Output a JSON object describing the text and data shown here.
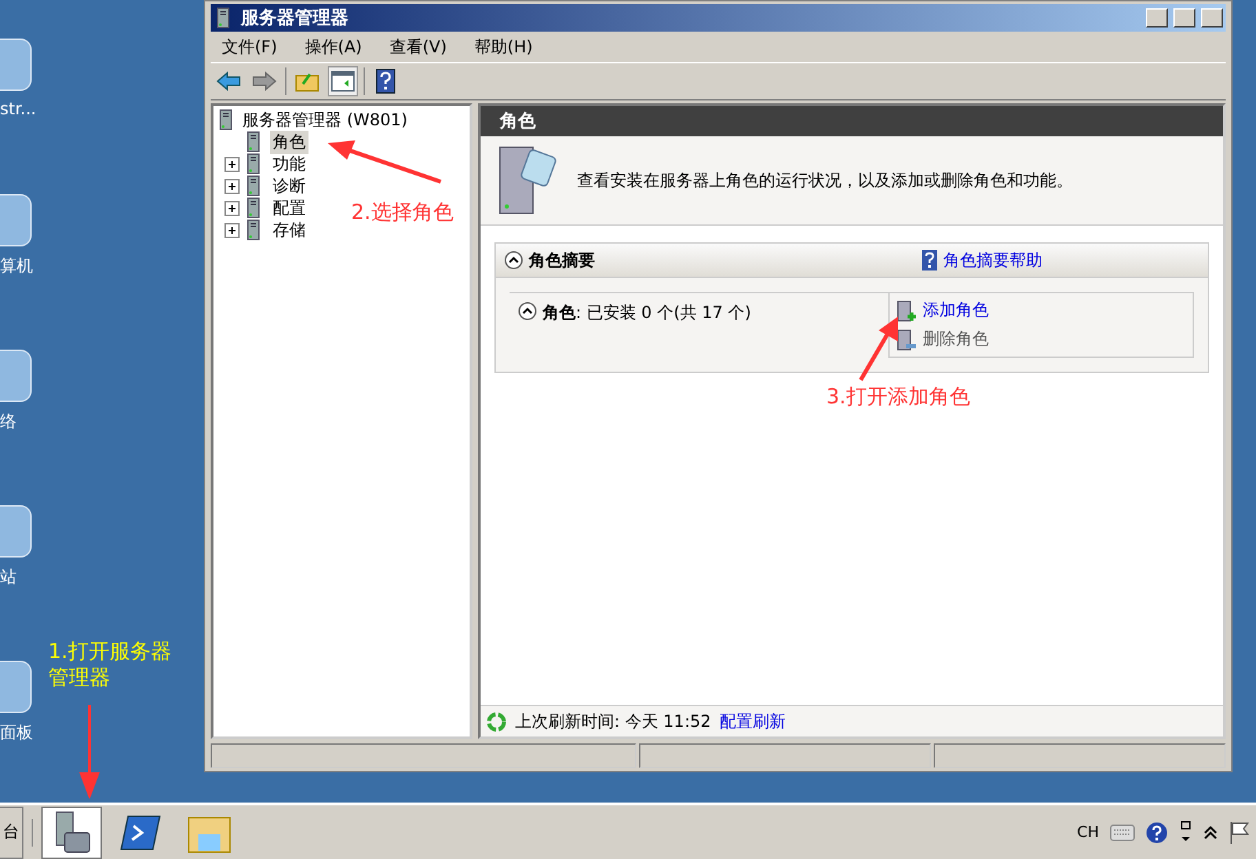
{
  "desktop_icons": [
    {
      "label": "str..."
    },
    {
      "label": "算机"
    },
    {
      "label": "络"
    },
    {
      "label": "站"
    },
    {
      "label": "面板"
    }
  ],
  "window": {
    "title": "服务器管理器",
    "menu": [
      "文件(F)",
      "操作(A)",
      "查看(V)",
      "帮助(H)"
    ]
  },
  "tree": {
    "root": "服务器管理器 (W801)",
    "children": [
      {
        "label": "角色",
        "selected": true,
        "expandable": false
      },
      {
        "label": "功能",
        "selected": false,
        "expandable": true
      },
      {
        "label": "诊断",
        "selected": false,
        "expandable": true
      },
      {
        "label": "配置",
        "selected": false,
        "expandable": true
      },
      {
        "label": "存储",
        "selected": false,
        "expandable": true
      }
    ]
  },
  "pane": {
    "title": "角色",
    "description": "查看安装在服务器上角色的运行状况，以及添加或删除角色和功能。",
    "summary": {
      "title": "角色摘要",
      "help": "角色摘要帮助",
      "status": "**角色**: 已安装 0 个(共 17 个)",
      "actions": [
        {
          "label": "添加角色",
          "enabled": true
        },
        {
          "label": "删除角色",
          "enabled": false
        }
      ]
    },
    "refresh": {
      "text": "上次刷新时间: 今天 11:52",
      "link": "配置刷新"
    }
  },
  "annotations": [
    {
      "text": "1.打开服务器管理器",
      "color": "#ffff00"
    },
    {
      "text": "2.选择角色",
      "color": "#ff3333"
    },
    {
      "text": "3.打开添加角色",
      "color": "#ff3333"
    }
  ],
  "taskbar": {
    "start": "台",
    "language": "CH"
  }
}
